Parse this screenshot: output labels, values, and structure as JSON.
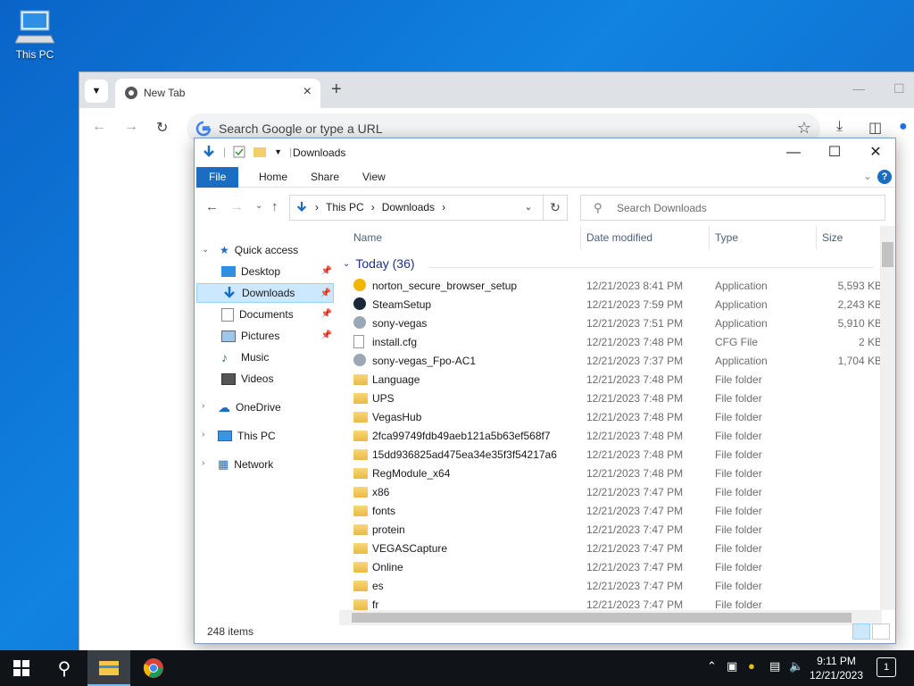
{
  "desktop": {
    "icon_label": "This PC"
  },
  "chrome": {
    "tab_title": "New Tab",
    "omnibox_placeholder": "Search Google or type a URL"
  },
  "explorer": {
    "window_title": "Downloads",
    "ribbon_tabs": [
      "File",
      "Home",
      "Share",
      "View"
    ],
    "help": "?",
    "breadcrumb": [
      "This PC",
      "Downloads"
    ],
    "search_placeholder": "Search Downloads",
    "nav": {
      "quick_access": "Quick access",
      "items": [
        "Desktop",
        "Downloads",
        "Documents",
        "Pictures",
        "Music",
        "Videos"
      ],
      "onedrive": "OneDrive",
      "this_pc": "This PC",
      "network": "Network"
    },
    "columns": {
      "name": "Name",
      "date": "Date modified",
      "type": "Type",
      "size": "Size"
    },
    "group": "Today (36)",
    "rows": [
      {
        "name": "norton_secure_browser_setup",
        "date": "12/21/2023 8:41 PM",
        "type": "Application",
        "size": "5,593 KB",
        "icon": "norton-app-icon"
      },
      {
        "name": "SteamSetup",
        "date": "12/21/2023 7:59 PM",
        "type": "Application",
        "size": "2,243 KB",
        "icon": "steam-app-icon"
      },
      {
        "name": "sony-vegas",
        "date": "12/21/2023 7:51 PM",
        "type": "Application",
        "size": "5,910 KB",
        "icon": "vegas-app-icon"
      },
      {
        "name": "install.cfg",
        "date": "12/21/2023 7:48 PM",
        "type": "CFG File",
        "size": "2 KB",
        "icon": "file-icon"
      },
      {
        "name": "sony-vegas_Fpo-AC1",
        "date": "12/21/2023 7:37 PM",
        "type": "Application",
        "size": "1,704 KB",
        "icon": "installer-app-icon"
      },
      {
        "name": "Language",
        "date": "12/21/2023 7:48 PM",
        "type": "File folder",
        "size": "",
        "icon": "folder-icon"
      },
      {
        "name": "UPS",
        "date": "12/21/2023 7:48 PM",
        "type": "File folder",
        "size": "",
        "icon": "folder-icon"
      },
      {
        "name": "VegasHub",
        "date": "12/21/2023 7:48 PM",
        "type": "File folder",
        "size": "",
        "icon": "folder-icon"
      },
      {
        "name": "2fca99749fdb49aeb121a5b63ef568f7",
        "date": "12/21/2023 7:48 PM",
        "type": "File folder",
        "size": "",
        "icon": "folder-icon"
      },
      {
        "name": "15dd936825ad475ea34e35f3f54217a6",
        "date": "12/21/2023 7:48 PM",
        "type": "File folder",
        "size": "",
        "icon": "folder-icon"
      },
      {
        "name": "RegModule_x64",
        "date": "12/21/2023 7:48 PM",
        "type": "File folder",
        "size": "",
        "icon": "folder-icon"
      },
      {
        "name": "x86",
        "date": "12/21/2023 7:47 PM",
        "type": "File folder",
        "size": "",
        "icon": "folder-icon"
      },
      {
        "name": "fonts",
        "date": "12/21/2023 7:47 PM",
        "type": "File folder",
        "size": "",
        "icon": "folder-icon"
      },
      {
        "name": "protein",
        "date": "12/21/2023 7:47 PM",
        "type": "File folder",
        "size": "",
        "icon": "folder-icon"
      },
      {
        "name": "VEGASCapture",
        "date": "12/21/2023 7:47 PM",
        "type": "File folder",
        "size": "",
        "icon": "folder-icon"
      },
      {
        "name": "Online",
        "date": "12/21/2023 7:47 PM",
        "type": "File folder",
        "size": "",
        "icon": "folder-icon"
      },
      {
        "name": "es",
        "date": "12/21/2023 7:47 PM",
        "type": "File folder",
        "size": "",
        "icon": "folder-icon"
      },
      {
        "name": "fr",
        "date": "12/21/2023 7:47 PM",
        "type": "File folder",
        "size": "",
        "icon": "folder-icon"
      }
    ],
    "status": "248 items"
  },
  "taskbar": {
    "time": "9:11 PM",
    "date": "12/21/2023",
    "notification_count": "1"
  },
  "colors": {
    "accent": "#1a6dc0",
    "selection": "#cce8ff",
    "taskbar": "#101418"
  }
}
